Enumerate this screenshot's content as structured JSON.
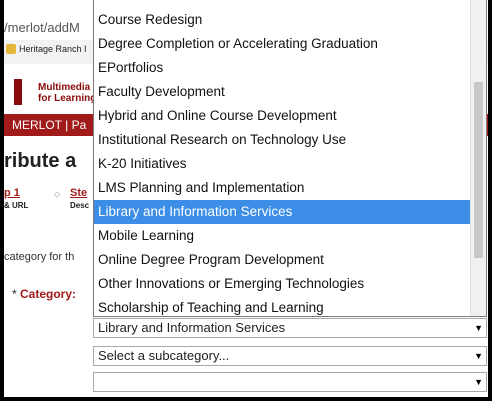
{
  "browser": {
    "url": "/merlot/addM",
    "bookmark": "Heritage Ranch I"
  },
  "site": {
    "logo_line1": "Multimedia",
    "logo_line2": "for Learning",
    "nav": "MERLOT | Pa",
    "heading": "ribute a",
    "step1_label": "p 1",
    "step1_sub": "& URL",
    "step2_label": "Ste",
    "step2_sub": "Desc",
    "category_hint": "category for th",
    "category_label": "Category:",
    "required_star": "*"
  },
  "dropdown": {
    "options": [
      "Course Redesign",
      "Degree Completion or Accelerating Graduation",
      "EPortfolios",
      "Faculty Development",
      "Hybrid and Online Course Development",
      "Institutional Research on Technology Use",
      "K-20 Initiatives",
      "LMS Planning and Implementation",
      "Library and Information Services",
      "Mobile Learning",
      "Online Degree Program Development",
      "Other Innovations or Emerging Technologies",
      "Scholarship of Teaching and Learning"
    ],
    "highlighted": "Library and Information Services"
  },
  "selects": {
    "category_value": "Library and Information Services",
    "subcategory_value": "Select a subcategory...",
    "third_value": "",
    "arrow": "▼"
  },
  "colors": {
    "brand_red": "#a21b1b",
    "highlight": "#3b8de6"
  }
}
